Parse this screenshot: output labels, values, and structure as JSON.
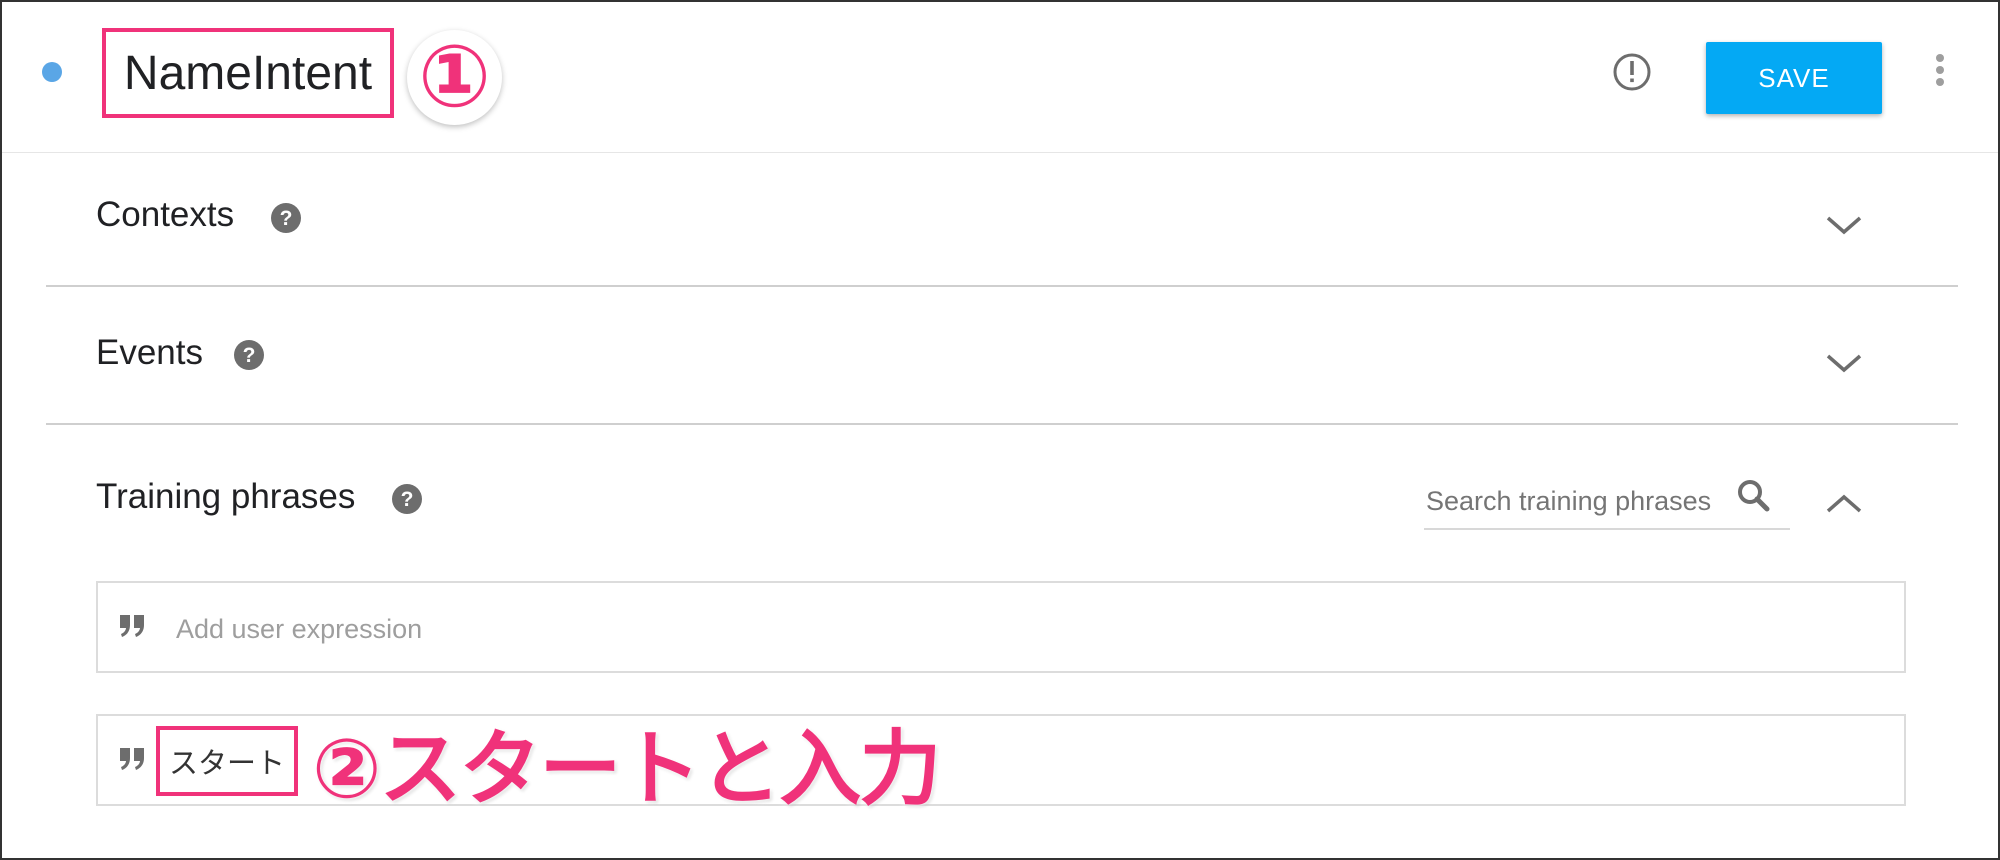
{
  "header": {
    "intent_name": "NameIntent",
    "annotation_1": "①",
    "save_label": "SAVE",
    "status_dot_color": "#5aa6e6",
    "accent_color": "#04a9f4",
    "annotation_color": "#f0327a"
  },
  "sections": {
    "contexts": {
      "title": "Contexts",
      "expanded": false
    },
    "events": {
      "title": "Events",
      "expanded": false
    },
    "training_phrases": {
      "title": "Training phrases",
      "expanded": true,
      "search_placeholder": "Search training phrases",
      "new_phrase_placeholder": "Add user expression",
      "phrases": [
        {
          "text": "スタート"
        }
      ]
    }
  },
  "annotations": {
    "step_2": "②スタートと入力"
  },
  "icons": {
    "status": "status-dot",
    "alert": "alert-circle-icon",
    "more": "more-vert-icon",
    "help": "help-circle-icon",
    "expand": "chevron-down-icon",
    "collapse": "chevron-up-icon",
    "search": "search-icon",
    "quote": "quote-icon"
  }
}
